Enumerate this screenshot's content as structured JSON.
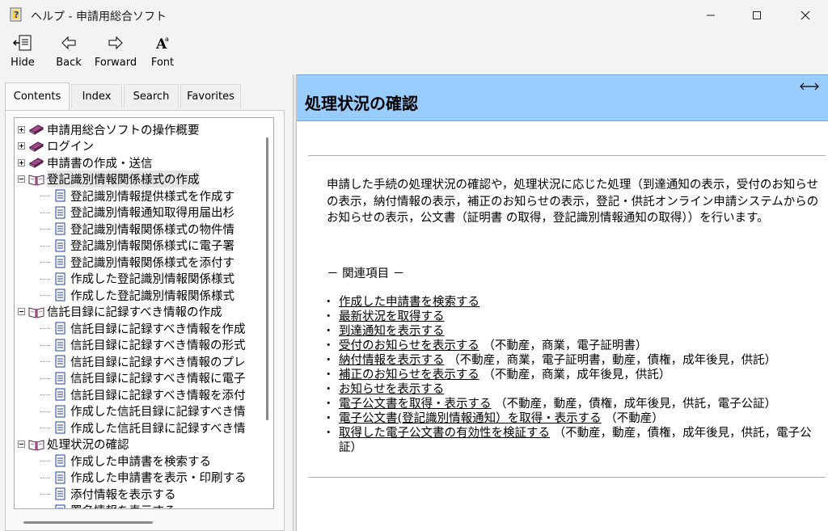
{
  "window": {
    "title": "ヘルプ - 申請用総合ソフト"
  },
  "toolbar": {
    "hide": "Hide",
    "back": "Back",
    "forward": "Forward",
    "font": "Font"
  },
  "tabs": [
    "Contents",
    "Index",
    "Search",
    "Favorites"
  ],
  "tree": [
    {
      "level": 0,
      "type": "book",
      "expander": "plus",
      "label": "申請用総合ソフトの操作概要"
    },
    {
      "level": 0,
      "type": "book",
      "expander": "plus",
      "label": "ログイン"
    },
    {
      "level": 0,
      "type": "book",
      "expander": "plus",
      "label": "申請書の作成・送信"
    },
    {
      "level": 0,
      "type": "openbook",
      "expander": "minus",
      "label": "登記識別情報関係様式の作成"
    },
    {
      "level": 1,
      "type": "page",
      "label": "登記識別情報提供様式を作成す"
    },
    {
      "level": 1,
      "type": "page",
      "label": "登記識別情報通知取得用届出杉"
    },
    {
      "level": 1,
      "type": "page",
      "label": "登記識別情報関係様式の物件情"
    },
    {
      "level": 1,
      "type": "page",
      "label": "登記識別情報関係様式に電子署"
    },
    {
      "level": 1,
      "type": "page",
      "label": "登記識別情報関係様式を添付す"
    },
    {
      "level": 1,
      "type": "page",
      "label": "作成した登記識別情報関係様式"
    },
    {
      "level": 1,
      "type": "page",
      "label": "作成した登記識別情報関係様式"
    },
    {
      "level": 0,
      "type": "openbook",
      "expander": "minus",
      "label": "信託目録に記録すべき情報の作成"
    },
    {
      "level": 1,
      "type": "page",
      "label": "信託目録に記録すべき情報を作成"
    },
    {
      "level": 1,
      "type": "page",
      "label": "信託目録に記録すべき情報の形式"
    },
    {
      "level": 1,
      "type": "page",
      "label": "信託目録に記録すべき情報のプレ"
    },
    {
      "level": 1,
      "type": "page",
      "label": "信託目録に記録すべき情報に電子"
    },
    {
      "level": 1,
      "type": "page",
      "label": "信託目録に記録すべき情報を添付"
    },
    {
      "level": 1,
      "type": "page",
      "label": "作成した信託目録に記録すべき情"
    },
    {
      "level": 1,
      "type": "page",
      "label": "作成した信託目録に記録すべき情"
    },
    {
      "level": 0,
      "type": "openbook",
      "expander": "minus",
      "label": "処理状況の確認"
    },
    {
      "level": 1,
      "type": "page",
      "label": "作成した申請書を検索する"
    },
    {
      "level": 1,
      "type": "page",
      "label": "作成した申請書を表示・印刷する"
    },
    {
      "level": 1,
      "type": "page",
      "label": "添付情報を表示する"
    },
    {
      "level": 1,
      "type": "page",
      "label": "署名情報を表示する"
    }
  ],
  "topic": {
    "title": "処理状況の確認",
    "paragraph": "申請した手続の処理状況の確認や，処理状況に応じた処理（到達通知の表示，受付のお知らせの表示，納付情報の表示，補正のお知らせの表示，登記・供託オンライン申請システムからのお知らせの表示，公文書（証明書 の取得，登記識別情報通知の取得））を行います。",
    "related_heading": "－ 関連項目 －",
    "related": [
      {
        "link": "作成した申請書を検索する",
        "note": ""
      },
      {
        "link": "最新状況を取得する",
        "note": ""
      },
      {
        "link": "到達通知を表示する",
        "note": ""
      },
      {
        "link": "受付のお知らせを表示する",
        "note": "（不動産，商業，電子証明書）"
      },
      {
        "link": "納付情報を表示する",
        "note": "（不動産，商業，電子証明書，動産，債権，成年後見，供託）"
      },
      {
        "link": "補正のお知らせを表示する",
        "note": "（不動産，商業，成年後見，供託）"
      },
      {
        "link": "お知らせを表示する",
        "note": ""
      },
      {
        "link": "電子公文書を取得・表示する",
        "note": "（不動産，動産，債権，成年後見，供託，電子公証）"
      },
      {
        "link": "電子公文書(登記識別情報通知）を取得・表示する",
        "note": "（不動産）"
      },
      {
        "link": "取得した電子公文書の有効性を検証する",
        "note": "（不動産，動産，債権，成年後見，供託，電子公証）"
      }
    ]
  }
}
